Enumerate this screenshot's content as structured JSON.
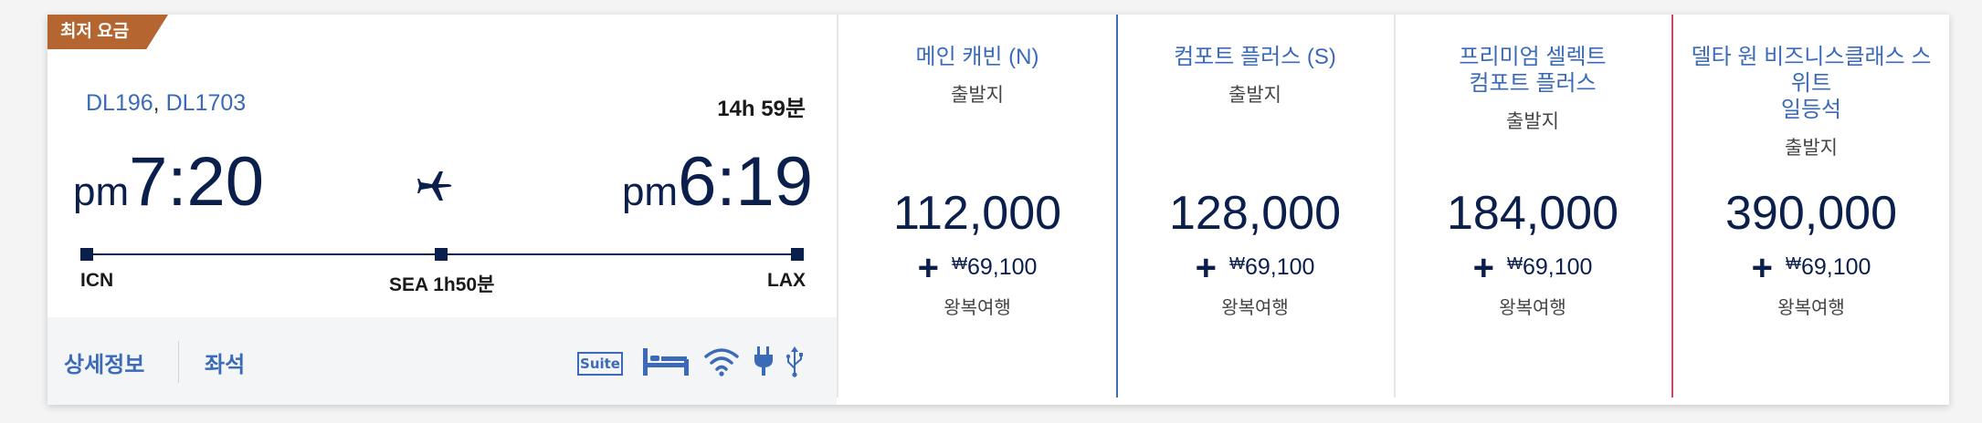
{
  "badge": {
    "label": "최저 요금"
  },
  "flight": {
    "number_1": "DL196",
    "separator": ",",
    "number_2": "DL1703",
    "duration": "14h 59분",
    "departure": {
      "ampm": "pm",
      "time": "7:20",
      "airport": "ICN"
    },
    "arrival": {
      "ampm": "pm",
      "time": "6:19",
      "airport": "LAX"
    },
    "layover": "SEA 1h50분",
    "plane_icon": "airplane-icon"
  },
  "footer": {
    "details_label": "상세정보",
    "seats_label": "좌석",
    "amenities": [
      "suite-icon",
      "flat-bed-icon",
      "wifi-icon",
      "power-outlet-icon",
      "usb-icon"
    ],
    "suite_text": "Suite"
  },
  "fares": [
    {
      "cabin": "메인 캐빈 (N)",
      "cabin_line2": "",
      "cabin_line3": "",
      "sub": "출발지",
      "price": "112,000",
      "currency": "₩",
      "tax": "69,100",
      "trip": "왕복여행"
    },
    {
      "cabin": "컴포트 플러스 (S)",
      "cabin_line2": "",
      "cabin_line3": "",
      "sub": "출발지",
      "price": "128,000",
      "currency": "₩",
      "tax": "69,100",
      "trip": "왕복여행"
    },
    {
      "cabin": "프리미엄 셀렉트",
      "cabin_line2": "컴포트 플러스",
      "cabin_line3": "",
      "sub": "출발지",
      "price": "184,000",
      "currency": "₩",
      "tax": "69,100",
      "trip": "왕복여행"
    },
    {
      "cabin": "델타 원 비즈니스클래스 스",
      "cabin_line2": "위트",
      "cabin_line3": "일등석",
      "sub": "출발지",
      "price": "390,000",
      "currency": "₩",
      "tax": "69,100",
      "trip": "왕복여행"
    }
  ],
  "colors": {
    "badge": "#b5652f",
    "link": "#3b6ab8",
    "navy": "#0b1f4d",
    "selected_divider_blue": "#3b6ab8",
    "selected_divider_red": "#c8495a"
  }
}
